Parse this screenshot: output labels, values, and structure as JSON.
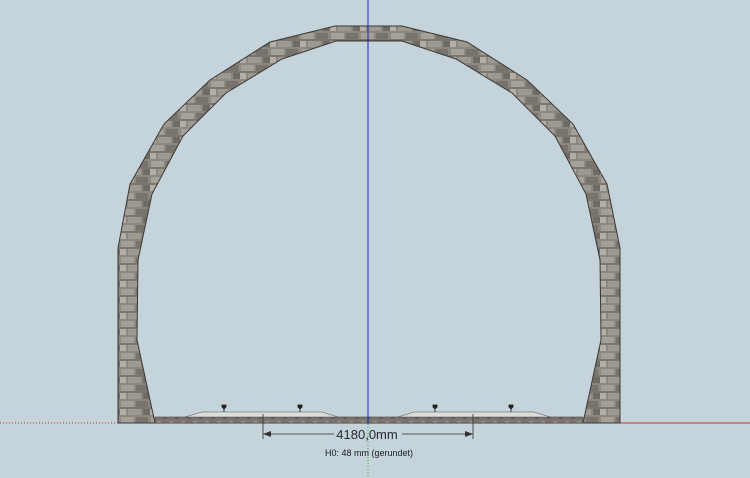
{
  "viewport": {
    "background_color": "#c5d3da",
    "axis_blue_color": "#2020c8",
    "axis_red_color": "#c83030",
    "axis_green_color": "#30a030",
    "model_stone_color": "#8c8880"
  },
  "model": {
    "object": "tunnel-portal",
    "material": "stone-masonry",
    "rails": "double-track"
  },
  "dimension": {
    "value_text": "4180,0mm"
  },
  "scale_note": {
    "text": "H0:  48 mm (gerundet)"
  }
}
